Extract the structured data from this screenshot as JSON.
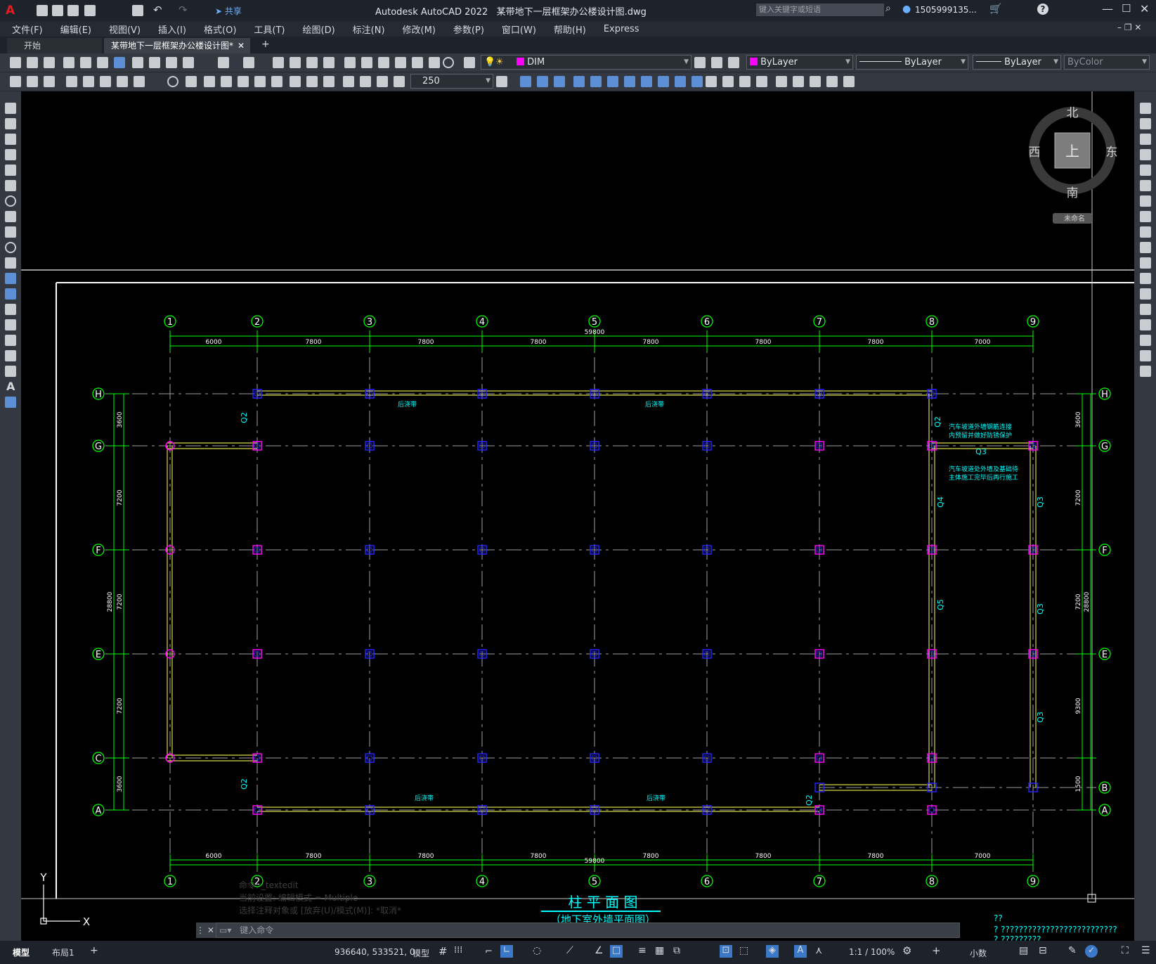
{
  "app": {
    "title": "Autodesk AutoCAD 2022",
    "file": "某带地下一层框架办公楼设计图.dwg",
    "search_placeholder": "键入关键字或短语",
    "user": "1505999135...",
    "share": "共享"
  },
  "menu": [
    "文件(F)",
    "编辑(E)",
    "视图(V)",
    "插入(I)",
    "格式(O)",
    "工具(T)",
    "绘图(D)",
    "标注(N)",
    "修改(M)",
    "参数(P)",
    "窗口(W)",
    "帮助(H)",
    "Express"
  ],
  "tabs": {
    "start": "开始",
    "doc": "某带地下一层框架办公楼设计图*"
  },
  "toolbar": {
    "layer": "DIM",
    "color": "ByLayer",
    "linetype1": "ByLayer",
    "linetype2": "ByLayer",
    "plotstyle": "ByColor",
    "scale": "250"
  },
  "viewcube": {
    "n": "北",
    "s": "南",
    "e": "东",
    "w": "西",
    "top": "上",
    "wcs": "未命名"
  },
  "drawing": {
    "grid_cols": [
      "1",
      "2",
      "3",
      "4",
      "5",
      "6",
      "7",
      "8",
      "9"
    ],
    "grid_rows": [
      "H",
      "G",
      "F",
      "E",
      "C",
      "A"
    ],
    "right_rows": [
      "H",
      "G",
      "F",
      "E",
      "B",
      "A"
    ],
    "top_dims": [
      "6000",
      "7800",
      "7800",
      "7800",
      "7800",
      "7800",
      "7800",
      "7000"
    ],
    "total_width": "59800",
    "left_dims": [
      "3600",
      "7200",
      "7200",
      "7200",
      "3600"
    ],
    "left_total": "28800",
    "right_dims": [
      "3600",
      "7200",
      "7200",
      "9300",
      "1500"
    ],
    "right_total": "28800",
    "title": "柱 平 面 图",
    "subtitle": "（地下室外墙平面图）",
    "note1": "汽车坡道外墙钢筋连接\n内预留并做好防锈保护",
    "note2": "汽车坡道处外墙及基础待\n主体施工完毕后再行施工",
    "post_pour": "后浇带",
    "walls": {
      "q2": "Q2",
      "q3": "Q3",
      "q4": "Q4",
      "q5": "Q5"
    }
  },
  "command": {
    "hist1": "命令: _textedit",
    "hist2": "当前设置: 编辑模式 = Multiple",
    "hist3": "选择注释对象或 [放弃(U)/模式(M)]: *取消*",
    "placeholder": "键入命令"
  },
  "status": {
    "model_tab": "模型",
    "layout_tab": "布局1",
    "coords": "936640, 533521, 0",
    "mode": "模型",
    "scale": "1:1 / 100%",
    "units": "小数",
    "err1": "??",
    "err2": "? ??????????????????????????",
    "err3": "? ????????? ."
  },
  "colors": {
    "green": "#00ff00",
    "blue": "#2323ff",
    "magenta": "#ff00ff",
    "yellow": "#d8d84a",
    "cyan": "#00ffff",
    "grey": "#a0a0a0"
  }
}
